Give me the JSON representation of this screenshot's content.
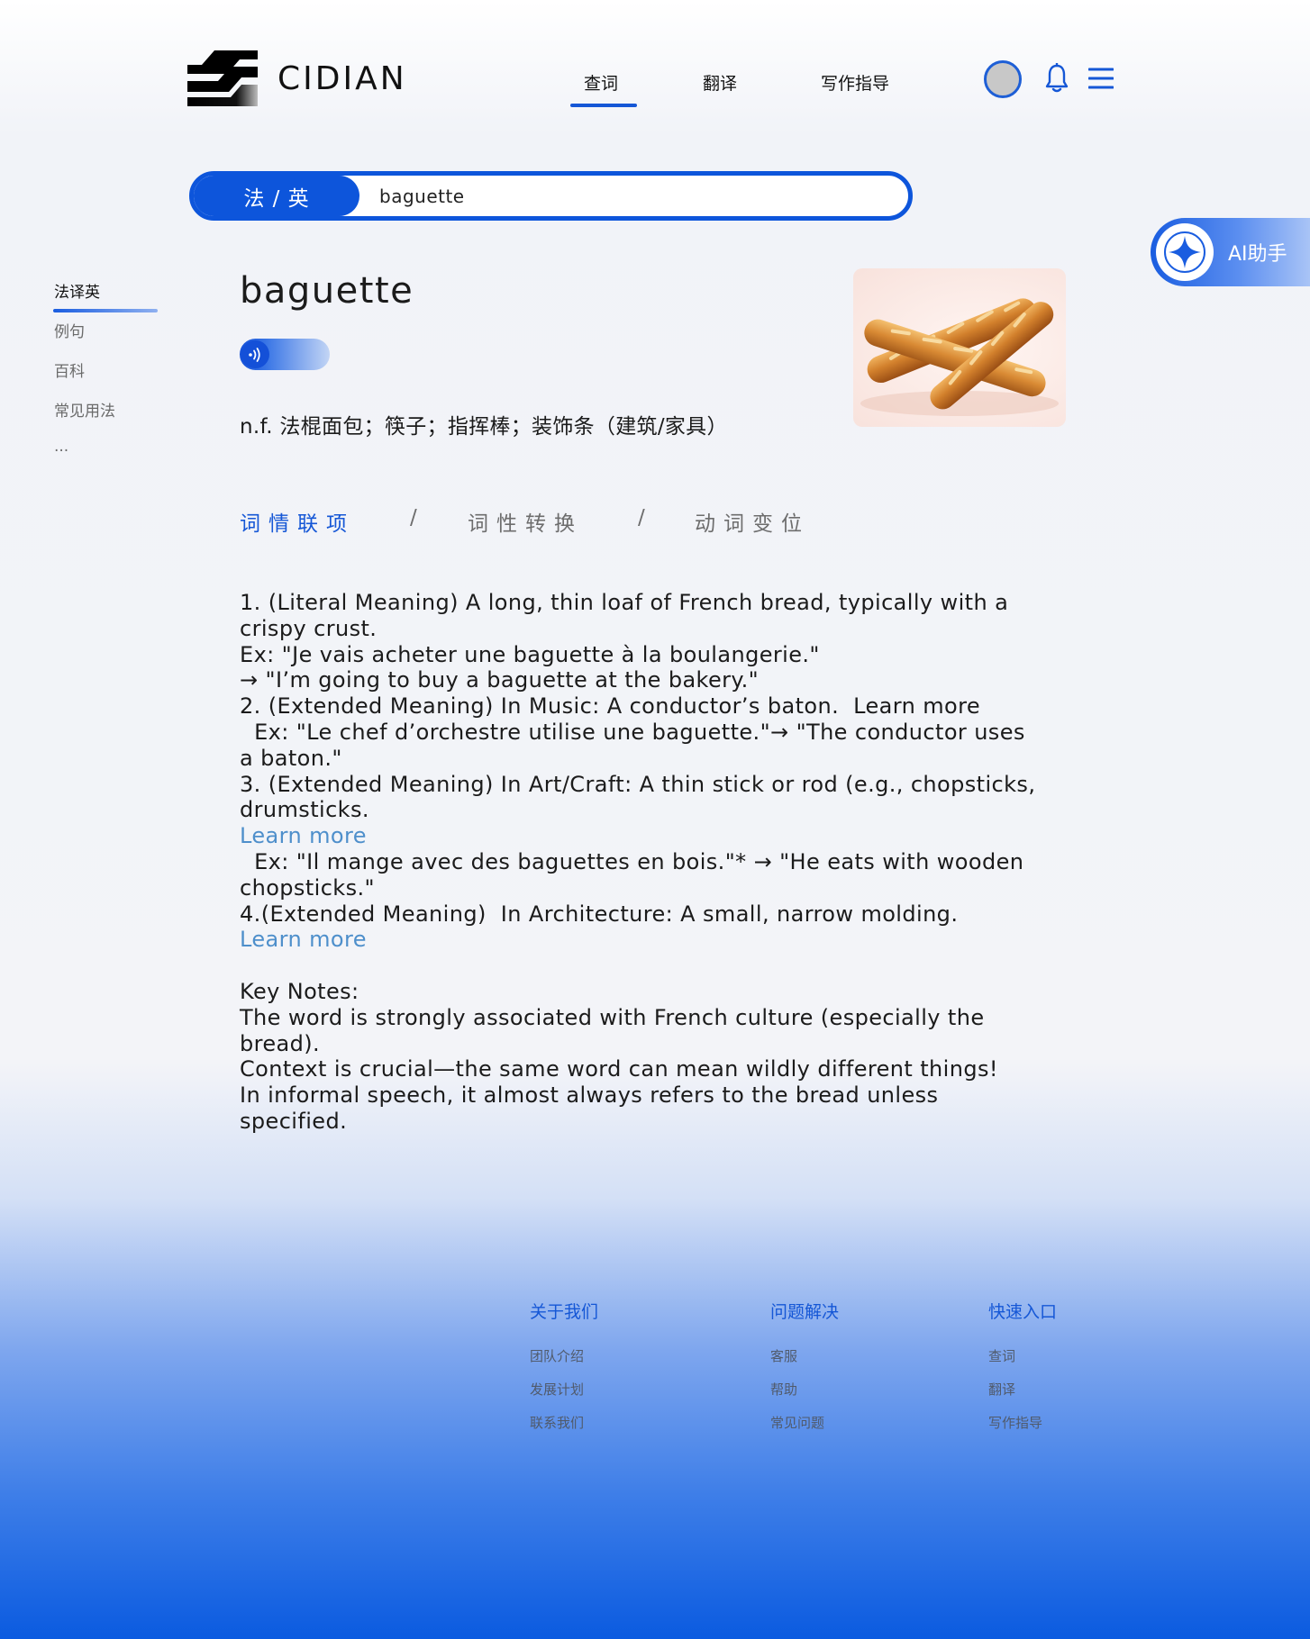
{
  "header": {
    "logo_text": "CIDIAN",
    "nav": [
      {
        "label": "查词",
        "active": true
      },
      {
        "label": "翻译",
        "active": false
      },
      {
        "label": "写作指导",
        "active": false
      }
    ],
    "icons": [
      "avatar",
      "bell-icon",
      "menu-icon"
    ]
  },
  "search": {
    "language_pair": "法 / 英",
    "query": "baguette"
  },
  "ai_assistant": {
    "label": "AI助手",
    "icon": "sparkle-icon"
  },
  "sidebar": {
    "items": [
      {
        "label": "法译英",
        "active": true
      },
      {
        "label": "例句",
        "active": false
      },
      {
        "label": "百科",
        "active": false
      },
      {
        "label": "常见用法",
        "active": false
      },
      {
        "label": "...",
        "active": false
      }
    ]
  },
  "entry": {
    "word": "baguette",
    "audio_icon": "speaker-icon",
    "definition": "n.f. 法棍面包；筷子；指挥棒；装饰条（建筑/家具）",
    "image_alt": "baguette-image"
  },
  "subtabs": [
    {
      "label": "词情联项",
      "active": true
    },
    {
      "label": "词性转换",
      "active": false
    },
    {
      "label": "动词变位",
      "active": false
    }
  ],
  "subtab_separator": "/",
  "content": {
    "lines": [
      {
        "text": "1. (Literal Meaning) A long, thin loaf of French bread, typically with a"
      },
      {
        "text": "crispy crust."
      },
      {
        "text": "Ex: \"Je vais acheter une baguette à la boulangerie.\""
      },
      {
        "text": "→ \"I’m going to buy a baguette at the bakery.\""
      },
      {
        "text": "2. (Extended Meaning) In Music: A conductor’s baton.  Learn more"
      },
      {
        "text": "  Ex: \"Le chef d’orchestre utilise une baguette.\"→ \"The conductor uses"
      },
      {
        "text": "a baton.\""
      },
      {
        "text": "3. (Extended Meaning) In Art/Craft: A thin stick or rod (e.g., chopsticks,"
      },
      {
        "text": "drumsticks."
      },
      {
        "text": "Learn more",
        "link": true
      },
      {
        "text": "  Ex: \"Il mange avec des baguettes en bois.\"* → \"He eats with wooden"
      },
      {
        "text": "chopsticks.\""
      },
      {
        "text": "4.(Extended Meaning)  In Architecture: A small, narrow molding."
      },
      {
        "text": "Learn more",
        "link": true
      },
      {
        "text": ""
      },
      {
        "text": "Key Notes:"
      },
      {
        "text": "The word is strongly associated with French culture (especially the"
      },
      {
        "text": "bread)."
      },
      {
        "text": "Context is crucial—the same word can mean wildly different things!"
      },
      {
        "text": "In informal speech, it almost always refers to the bread unless"
      },
      {
        "text": "specified."
      }
    ]
  },
  "footer": {
    "columns": [
      {
        "title": "关于我们",
        "links": [
          "团队介绍",
          "发展计划",
          "联系我们"
        ]
      },
      {
        "title": "问题解决",
        "links": [
          "客服",
          "帮助",
          "常见问题"
        ]
      },
      {
        "title": "快速入口",
        "links": [
          "查词",
          "翻译",
          "写作指导"
        ]
      }
    ]
  },
  "colors": {
    "brand_blue": "#0d55db",
    "link_blue": "#4e8fcb",
    "muted_text": "#6d6d6d"
  }
}
